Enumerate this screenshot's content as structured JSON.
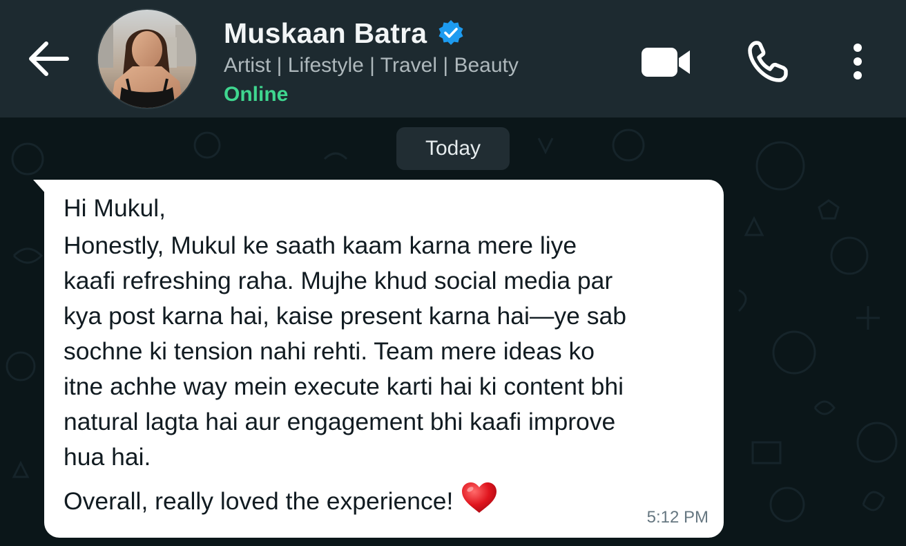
{
  "header": {
    "back_icon": "arrow-left-icon",
    "contact_name": "Muskaan Batra",
    "verified_icon": "verified-badge-icon",
    "tagline": "Artist | Lifestyle | Travel | Beauty",
    "status": "Online",
    "actions": [
      {
        "name": "video-call",
        "icon": "video-camera-icon"
      },
      {
        "name": "voice-call",
        "icon": "phone-icon"
      },
      {
        "name": "more-options",
        "icon": "vertical-dots-icon"
      }
    ]
  },
  "chat": {
    "date_separator": "Today",
    "message": {
      "greeting": "Hi Mukul,",
      "body_lines": [
        "Honestly, Mukul ke saath kaam karna mere liye",
        "kaafi refreshing raha. Mujhe khud social media par",
        "kya post karna hai, kaise present karna hai—ye sab",
        "sochne ki tension nahi rehti. Team mere ideas ko",
        "itne achhe way mein execute karti hai ki content bhi",
        "natural lagta hai aur engagement bhi kaafi improve",
        "hua hai."
      ],
      "closing": "Overall, really loved the experience!",
      "emoji": "red-heart-icon",
      "time": "5:12 PM"
    }
  },
  "colors": {
    "header_bg": "#1d2a30",
    "chat_bg": "#0b1619",
    "bubble_bg": "#ffffff",
    "online_green": "#3fd68f",
    "verified_blue": "#1d9bf0"
  }
}
